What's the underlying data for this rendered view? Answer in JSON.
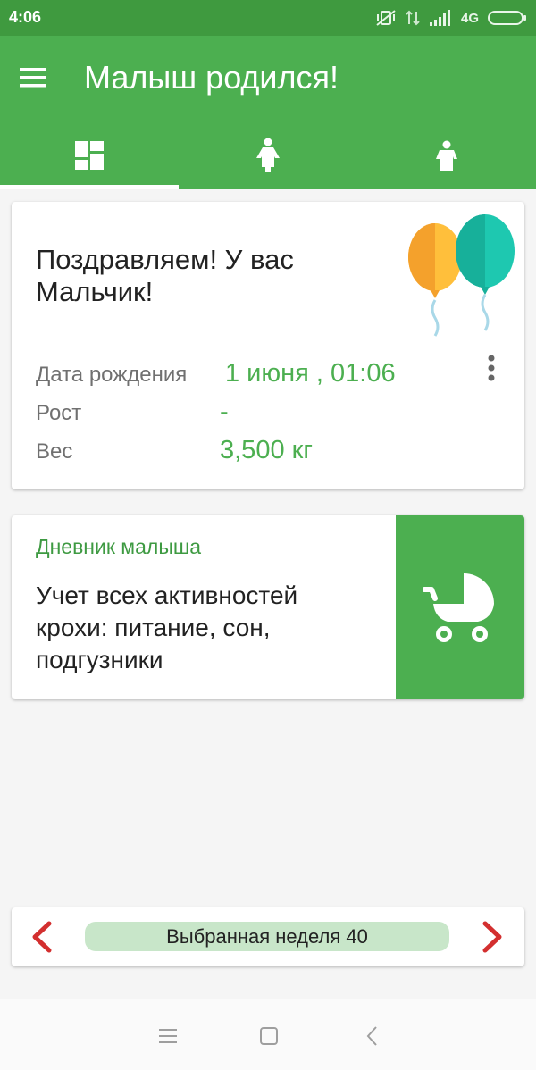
{
  "status_bar": {
    "time": "4:06",
    "network": "4G",
    "icons": [
      "vibrate-off-icon",
      "data-arrows-icon",
      "signal-icon",
      "battery-icon"
    ]
  },
  "app_bar": {
    "title": "Малыш родился!",
    "menu_icon": "hamburger-menu-icon",
    "tabs": [
      {
        "icon": "dashboard-icon",
        "selected": true
      },
      {
        "icon": "mother-icon",
        "selected": false
      },
      {
        "icon": "child-icon",
        "selected": false
      }
    ]
  },
  "birth_card": {
    "congrats": "Поздравляем! У вас Мальчик!",
    "image": "balloons-icon",
    "rows": [
      {
        "label": "Дата рождения",
        "value": "1 июня , 01:06"
      },
      {
        "label": "Рост",
        "value": "-"
      },
      {
        "label": "Вес",
        "value": "3,500 кг"
      }
    ]
  },
  "diary_card": {
    "title": "Дневник малыша",
    "text": "Учет всех активностей крохи: питание, сон, подгузники",
    "icon": "stroller-icon"
  },
  "week_selector": {
    "label": "Выбранная неделя 40",
    "prev_icon": "chevron-left-icon",
    "next_icon": "chevron-right-icon"
  },
  "nav_bar": {
    "buttons": [
      "menu-icon",
      "home-icon",
      "back-icon"
    ]
  },
  "colors": {
    "status_bar": "#3f9a3f",
    "primary": "#4caf50",
    "accent_text": "#3e9a42",
    "week_pill": "#c8e6c9",
    "arrow_red": "#d32f2f",
    "balloon_orange": "#ffbf3b",
    "balloon_teal": "#1ec8b0"
  }
}
